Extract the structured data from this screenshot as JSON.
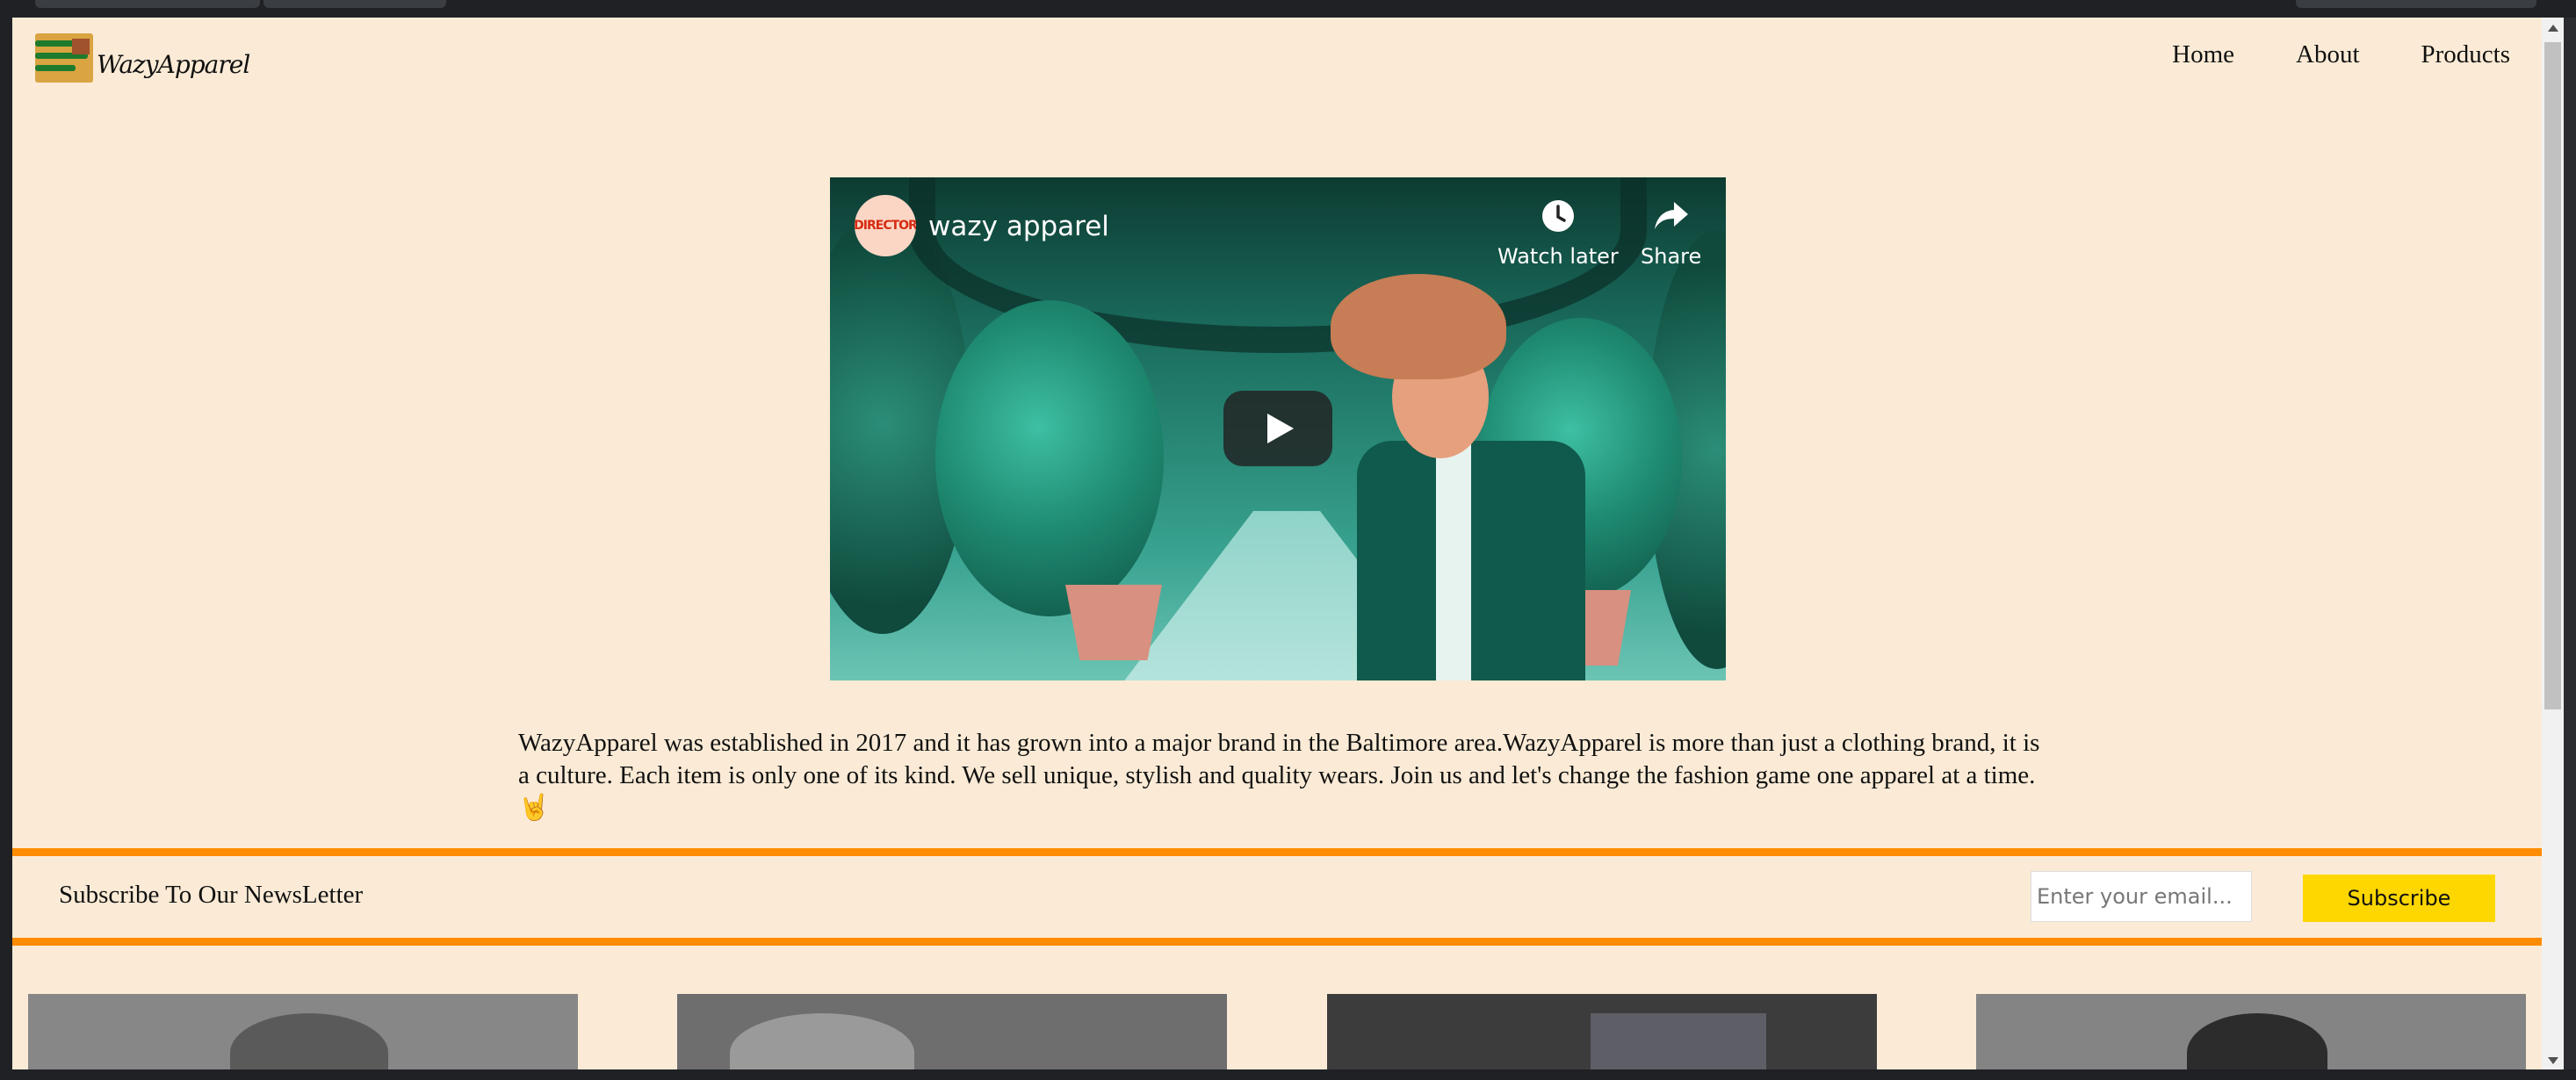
{
  "brand": {
    "name": "WazyApparel"
  },
  "nav": {
    "items": [
      "Home",
      "About",
      "Products"
    ]
  },
  "video": {
    "channel_badge": "DIRECTOR",
    "title": "wazy apparel",
    "watch_later": "Watch later",
    "share": "Share"
  },
  "about": {
    "text": "WazyApparel was established in 2017 and it has grown into a major brand in the Baltimore area.WazyApparel is more than just a clothing brand, it is a culture. Each item is only one of its kind. We sell unique, stylish and quality wears. Join us and let's change the fashion game one apparel at a time.",
    "emoji": "🤘"
  },
  "newsletter": {
    "label": "Subscribe To Our NewsLetter",
    "placeholder": "Enter your email...",
    "button": "Subscribe"
  },
  "colors": {
    "page_bg": "#fbebd6",
    "accent_rule": "#ff8c00",
    "subscribe_button": "#ffd700"
  }
}
